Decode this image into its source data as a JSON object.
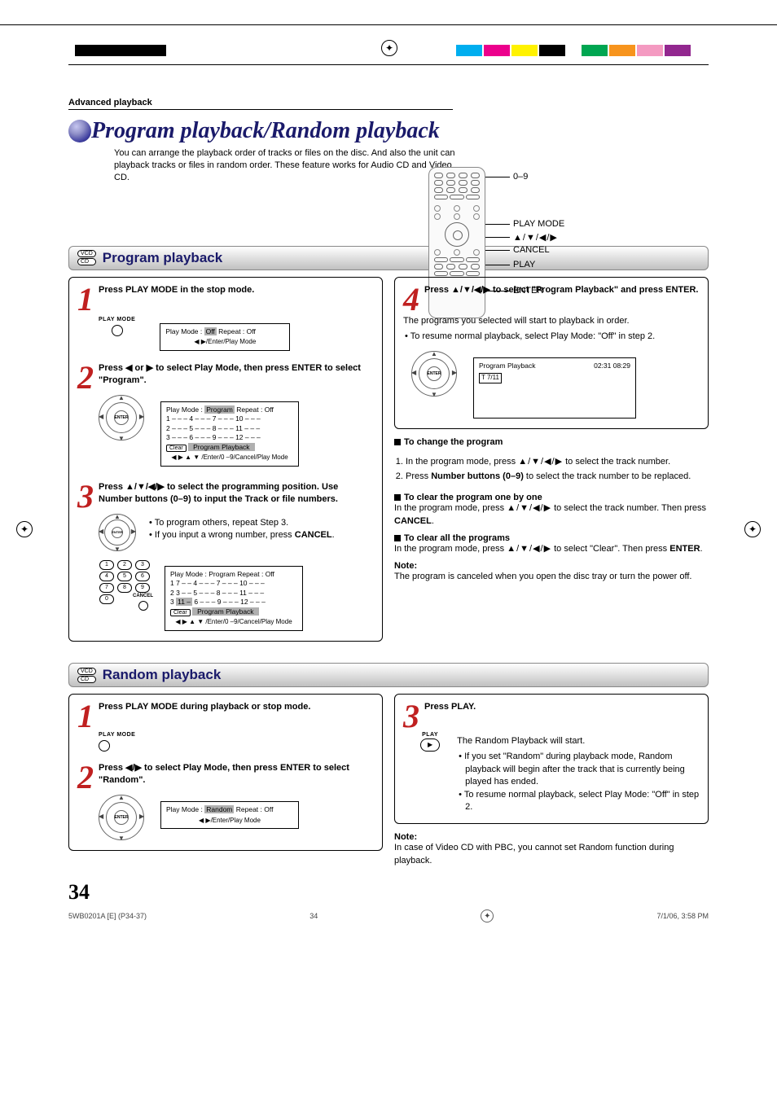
{
  "section_label": "Advanced playback",
  "page_title": "Program playback/Random playback",
  "intro": "You can arrange the playback order of tracks or files on the disc. And also the unit can playback tracks or files in random order. These feature works for Audio CD and Video CD.",
  "remote_labels": {
    "r1": "0–9",
    "r2": "PLAY MODE",
    "r3": "▲/▼/◀/▶",
    "r4": "CANCEL",
    "r5": "PLAY",
    "r6": "ENTER"
  },
  "band1": "Program playback",
  "band2": "Random playback",
  "disc_badges": {
    "b1": "VCD",
    "b2": "CD"
  },
  "prog_steps": {
    "s1": {
      "n": "1",
      "txt": "Press PLAY MODE in the stop mode.",
      "pm_label": "PLAY MODE",
      "osd": "Play Mode  :  Off     Repeat  :   Off",
      "osd_caption": "◀ ▶/Enter/Play Mode",
      "osd_hl": "Off"
    },
    "s2": {
      "n": "2",
      "txt": "Press ◀ or ▶ to select Play Mode, then press ENTER to select \"Program\".",
      "osd_l1": "Play Mode : ",
      "osd_hl": "Program",
      "osd_l1b": "   Repeat   :    Off",
      "grid": [
        "1 – – –   4 – – –   7 – – –  10 – – –",
        "2 – – –   5 – – –   8 – – –  11 – – –",
        "3 – – –   6 – – –   9 – – –  12 – – –"
      ],
      "osd_btm": "Clear        Program Playback",
      "osd_caption": "◀ ▶ ▲ ▼ /Enter/0 –9/Cancel/Play Mode",
      "enter_lbl": "ENTER"
    },
    "s3": {
      "n": "3",
      "txt": "Press ▲/▼/◀/▶ to select the programming position. Use Number buttons (0–9) to input the Track or file numbers.",
      "bullets": [
        "To program others, repeat Step 3.",
        "If you input a wrong number, press CANCEL."
      ],
      "cancel_lbl": "CANCEL",
      "osd_l1": "Play Mode  :  Program    Repeat    :     Off",
      "grid": [
        "1  7 – –   4 – – –   7 – – –  10 – – –",
        "2  3 – –   5 – – –   8 – – –  11 – – –",
        "3 11 – –   6 – – –   9 – – –  12 – – –"
      ],
      "osd_hl_cell": "11 –",
      "osd_btm": "Clear        Program Playback",
      "osd_caption": "◀ ▶ ▲ ▼ /Enter/0 –9/Cancel/Play Mode",
      "numpad": [
        "1",
        "2",
        "3",
        "4",
        "5",
        "6",
        "7",
        "8",
        "9",
        "0"
      ]
    },
    "s4": {
      "n": "4",
      "txt": "Press ▲/▼/◀/▶ to select \"Program Playback\" and press ENTER.",
      "body": "The programs you selected will start to playback in order.",
      "bullets": [
        "To resume normal playback, select Play Mode: \"Off\" in step 2."
      ],
      "osd_title": "Program Playback",
      "osd_time": "02:31   08:29",
      "osd_track": "T  7/11",
      "enter_lbl": "ENTER"
    }
  },
  "change_section": {
    "h1": "To change the program",
    "l1_pre": "In the program mode, press ",
    "l1_arrows": "▲/▼/◀/▶",
    "l1_post": " to select the track number.",
    "l2_pre": "Press ",
    "l2_bold": "Number buttons (0–9)",
    "l2_post": " to select the track number to be replaced.",
    "h2": "To clear the program one by one",
    "clr1_pre": "In the program mode, press ",
    "clr1_arrows": "▲/▼/◀/▶",
    "clr1_mid": " to select the track number. Then press ",
    "clr1_bold": "CANCEL",
    "clr1_post": ".",
    "h3": "To clear all the programs",
    "clr2_pre": "In the program mode, press ",
    "clr2_arrows": "▲/▼/◀/▶",
    "clr2_mid": " to select \"Clear\". Then press ",
    "clr2_bold": "ENTER",
    "clr2_post": ".",
    "note_t": "Note:",
    "note_b": "The program is canceled when you open the disc tray or turn the power off."
  },
  "rand_steps": {
    "s1": {
      "n": "1",
      "txt": "Press PLAY MODE during playback or stop mode.",
      "pm_label": "PLAY MODE"
    },
    "s2": {
      "n": "2",
      "txt": "Press ◀/▶ to select Play Mode, then press ENTER to select \"Random\".",
      "osd": "Play Mode : ",
      "osd_hl": "Random",
      "osd_b": " Repeat  :   Off",
      "osd_caption": "◀ ▶/Enter/Play Mode",
      "enter_lbl": "ENTER"
    },
    "s3": {
      "n": "3",
      "txt": "Press PLAY.",
      "play_lbl": "PLAY",
      "body": "The Random Playback will start.",
      "bullets": [
        "If you set \"Random\" during playback mode, Random playback will begin after the track that is currently being played has ended.",
        "To resume normal playback, select Play Mode: \"Off\" in step 2."
      ]
    }
  },
  "rand_note": {
    "t": "Note:",
    "b": "In case of Video CD with PBC, you cannot set Random function during playback."
  },
  "page_number": "34",
  "footer": {
    "left": "5WB0201A [E] (P34-37)",
    "mid": "34",
    "right": "7/1/06, 3:58 PM"
  }
}
